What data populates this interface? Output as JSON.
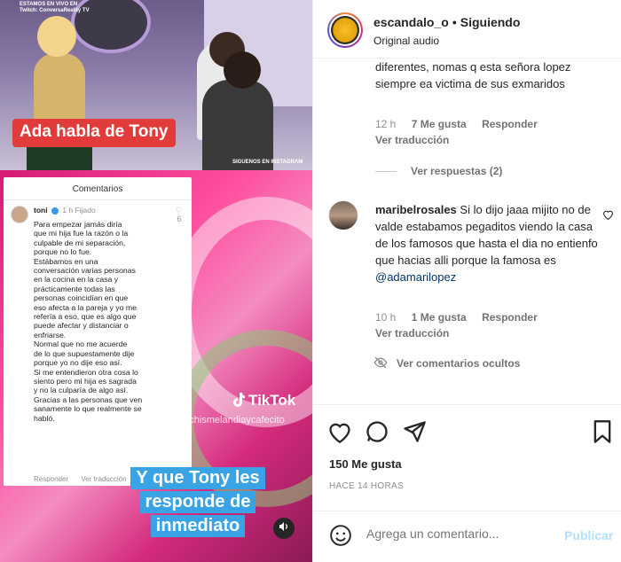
{
  "media": {
    "live_text": "ESTAMOS EN VIVO EN\nTwitch: ConversaReality TV",
    "ig_text": "SIGUENOS EN INSTAGRAM",
    "caption_top": "Ada habla de Tony",
    "comments_card": {
      "header": "Comentarios",
      "user": "toni",
      "time": "1 h",
      "pinned": "Fijado",
      "likes": "6",
      "text": "Para empezar jamás diría\nque mi hija fue la razón o la\nculpable de mi separación,\nporque no lo fue.\nEstábamos en una\nconversación varias personas\nen la cocina en la casa y\nprácticamente todas las\npersonas coincidían en que\neso afecta a la pareja y yo me\nrefería a eso, que es algo que\npuede afectar y distanciar o\nenfriarse.\nNormal que no me acuerde\nde lo que supuestamente dije\nporque yo no dije eso así.\nSi me entendieron otra cosa lo\nsiento pero mi hija es sagrada\ny no la culparía de algo así.\nGracias a las personas que ven\nsanamente lo que realmente se\nhabló.",
      "reply": "Responder",
      "translate": "Ver traducción"
    },
    "tiktok_label": "TikTok",
    "tiktok_handle": "@chismelandiaycafecito",
    "caption_bottom": [
      "Y que Tony les",
      "responde de",
      "inmediato"
    ]
  },
  "header": {
    "username": "escandalo_o",
    "separator": "•",
    "follow_status": "Siguiendo",
    "audio": "Original audio"
  },
  "comment1": {
    "text": "diferentes, nomas q esta señora lopez siempre ea victima de sus exmaridos",
    "time": "12 h",
    "likes": "7 Me gusta",
    "reply": "Responder",
    "translate": "Ver traducción",
    "view_replies": "Ver respuestas (2)"
  },
  "comment2": {
    "username": "maribelrosales",
    "text": " Si lo dijo jaaa mijito no de valde estabamos pegaditos viendo la casa de los famosos que hasta el dia no entienfo que hacias alli porque la famosa es ",
    "mention": "@adamarilopez",
    "time": "10 h",
    "likes": "1 Me gusta",
    "reply": "Responder",
    "translate": "Ver traducción"
  },
  "hidden_comments": "Ver comentarios ocultos",
  "post": {
    "likes": "150 Me gusta",
    "time": "HACE 14 HORAS"
  },
  "composer": {
    "placeholder": "Agrega un comentario...",
    "publish": "Publicar"
  }
}
